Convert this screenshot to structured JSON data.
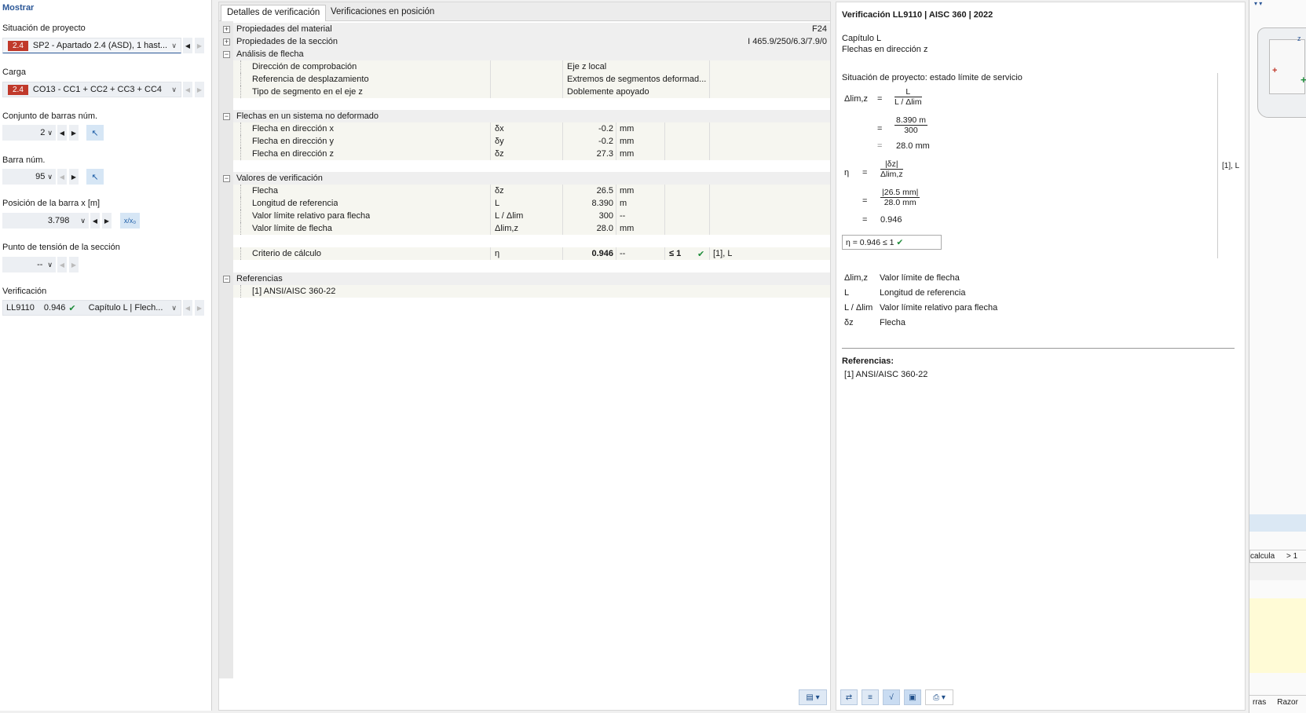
{
  "left": {
    "title": "Mostrar",
    "situacion_label": "Situación de proyecto",
    "situacion_badge": "2.4",
    "situacion_value": "SP2 - Apartado 2.4 (ASD), 1 hast...",
    "carga_label": "Carga",
    "carga_badge": "2.4",
    "carga_value": "CO13 - CC1 + CC2 + CC3 + CC4",
    "conjunto_label": "Conjunto de barras núm.",
    "conjunto_value": "2",
    "barra_label": "Barra núm.",
    "barra_value": "95",
    "posicion_label": "Posición de la barra x [m]",
    "posicion_value": "3.798",
    "posicion_btn": "x/x₀",
    "punto_label": "Punto de tensión de la sección",
    "punto_value": "--",
    "verif_label": "Verificación",
    "verif_id": "LL9110",
    "verif_ratio": "0.946",
    "verif_value": "Capítulo L | Flech..."
  },
  "tabs": [
    "Detalles de verificación",
    "Verificaciones en posición"
  ],
  "table": {
    "material": {
      "label": "Propiedades del material",
      "value": "F24"
    },
    "seccion": {
      "label": "Propiedades de la sección",
      "value": "I 465.9/250/6.3/7.9/0"
    },
    "analisis": {
      "label": "Análisis de flecha",
      "rows": [
        {
          "name": "Dirección de comprobación",
          "value": "Eje z local"
        },
        {
          "name": "Referencia de desplazamiento",
          "value": "Extremos de segmentos deformad..."
        },
        {
          "name": "Tipo de segmento en el eje z",
          "value": "Doblemente apoyado"
        }
      ]
    },
    "flechas": {
      "label": "Flechas en un sistema no deformado",
      "rows": [
        {
          "name": "Flecha en dirección x",
          "sym": "δx",
          "value": "-0.2",
          "unit": "mm"
        },
        {
          "name": "Flecha en dirección y",
          "sym": "δy",
          "value": "-0.2",
          "unit": "mm"
        },
        {
          "name": "Flecha en dirección z",
          "sym": "δz",
          "value": "27.3",
          "unit": "mm"
        }
      ]
    },
    "valores": {
      "label": "Valores de verificación",
      "rows": [
        {
          "name": "Flecha",
          "sym": "δz",
          "value": "26.5",
          "unit": "mm"
        },
        {
          "name": "Longitud de referencia",
          "sym": "L",
          "value": "8.390",
          "unit": "m"
        },
        {
          "name": "Valor límite relativo para flecha",
          "sym": "L / Δlim",
          "value": "300",
          "unit": "--"
        },
        {
          "name": "Valor límite de flecha",
          "sym": "Δlim,z",
          "value": "28.0",
          "unit": "mm"
        }
      ],
      "criterio": {
        "name": "Criterio de cálculo",
        "sym": "η",
        "value": "0.946",
        "unit": "--",
        "limit": "≤ 1",
        "ref": "[1], L"
      }
    },
    "referencias": {
      "label": "Referencias",
      "item": "[1]  ANSI/AISC 360-22"
    }
  },
  "right": {
    "title": "Verificación LL9110 | AISC 360 | 2022",
    "chapter": "Capítulo L",
    "subtitle": "Flechas en dirección z",
    "situation": "Situación de proyecto: estado límite de servicio",
    "f1_lhs": "Δlim,z",
    "f1_num": "L",
    "f1_den": "L / Δlim",
    "f1_num2": "8.390 m",
    "f1_den2": "300",
    "f1_res": "28.0 mm",
    "f2_lhs": "η",
    "f2_num": "|δz|",
    "f2_den": "Δlim,z",
    "f2_num2": "|26.5 mm|",
    "f2_den2": "28.0 mm",
    "f2_res": "0.946",
    "ref_tag": "[1], L",
    "result": "η   =   0.946  ≤ 1",
    "legend": [
      {
        "sym": "Δlim,z",
        "desc": "Valor límite de flecha"
      },
      {
        "sym": "L",
        "desc": "Longitud de referencia"
      },
      {
        "sym": "L / Δlim",
        "desc": "Valor límite relativo para flecha"
      },
      {
        "sym": "δz",
        "desc": "Flecha"
      }
    ],
    "refs_title": "Referencias:",
    "refs_item": "[1]   ANSI/AISC 360-22"
  },
  "far": {
    "calc_text": "calcula",
    "gt_text": "> 1",
    "tab1": "rras",
    "tab2": "Razor"
  }
}
